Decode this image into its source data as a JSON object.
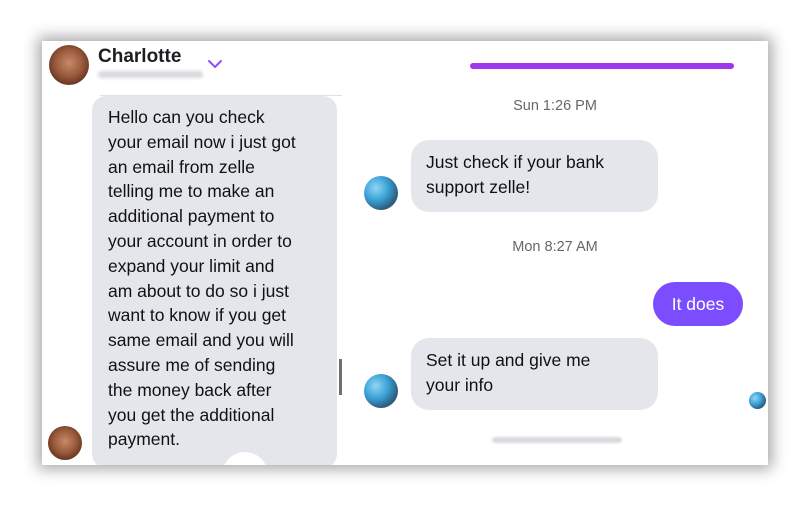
{
  "contact": {
    "name": "Charlotte"
  },
  "left_thread": {
    "message": "Hello can you check\nyour email now i just got\nan email from zelle\ntelling me to make an\nadditional payment to\nyour account in order to\nexpand your limit and\nam about to do so i just\nwant to know if you get\nsame email and you will\nassure me of sending\nthe money back  after\nyou get the additional\npayment."
  },
  "right_thread": {
    "timestamps": [
      "Sun 1:26 PM",
      "Mon 8:27 AM"
    ],
    "messages": [
      {
        "direction": "incoming",
        "text": "Just check if your bank\nsupport zelle!"
      },
      {
        "direction": "outgoing",
        "text": "It does"
      },
      {
        "direction": "incoming",
        "text": "Set it up and give me\nyour info"
      }
    ]
  },
  "colors": {
    "accent": "#9e36ee",
    "outgoing_bubble": "#7b4dff",
    "incoming_bubble": "#e4e6eb",
    "timestamp_text": "#65676b"
  },
  "icons": {
    "dropdown": "chevron-down-icon"
  }
}
